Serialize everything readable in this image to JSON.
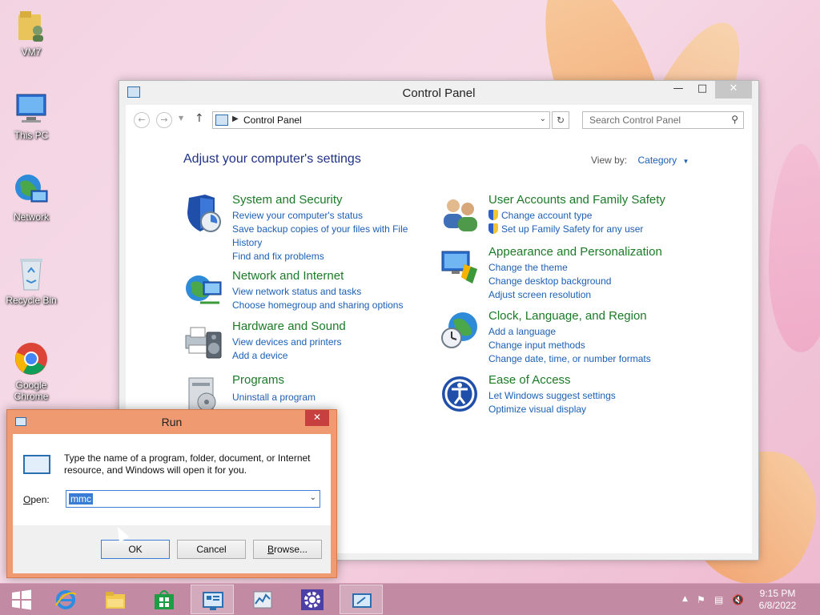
{
  "desktop": {
    "icons": [
      {
        "label": "VM7"
      },
      {
        "label": "This PC"
      },
      {
        "label": "Network"
      },
      {
        "label": "Recycle Bin"
      },
      {
        "label": "Google Chrome"
      }
    ]
  },
  "control_panel": {
    "title": "Control Panel",
    "address": "Control Panel",
    "search_placeholder": "Search Control Panel",
    "heading": "Adjust your computer's settings",
    "view_by_label": "View by:",
    "view_by_value": "Category",
    "categories": [
      {
        "title": "System and Security",
        "links": [
          "Review your computer's status",
          "Save backup copies of your files with File",
          "History",
          "Find and fix problems"
        ]
      },
      {
        "title": "Network and Internet",
        "links": [
          "View network status and tasks",
          "Choose homegroup and sharing options"
        ]
      },
      {
        "title": "Hardware and Sound",
        "links": [
          "View devices and printers",
          "Add a device"
        ]
      },
      {
        "title": "Programs",
        "links": [
          "Uninstall a program"
        ]
      },
      {
        "title": "User Accounts and Family Safety",
        "links": [
          "Change account type",
          "Set up Family Safety for any user"
        ]
      },
      {
        "title": "Appearance and Personalization",
        "links": [
          "Change the theme",
          "Change desktop background",
          "Adjust screen resolution"
        ]
      },
      {
        "title": "Clock, Language, and Region",
        "links": [
          "Add a language",
          "Change input methods",
          "Change date, time, or number formats"
        ]
      },
      {
        "title": "Ease of Access",
        "links": [
          "Let Windows suggest settings",
          "Optimize visual display"
        ]
      }
    ]
  },
  "run_dialog": {
    "title": "Run",
    "description": "Type the name of a program, folder, document, or Internet resource, and Windows will open it for you.",
    "open_label_prefix": "",
    "open_label_underlined": "O",
    "open_label_rest": "pen:",
    "input_value": "mmc",
    "ok_label": "OK",
    "cancel_label": "Cancel",
    "browse_prefix": "",
    "browse_underlined": "B",
    "browse_rest": "rowse..."
  },
  "taskbar": {
    "time": "9:15 PM",
    "date": "6/8/2022"
  }
}
